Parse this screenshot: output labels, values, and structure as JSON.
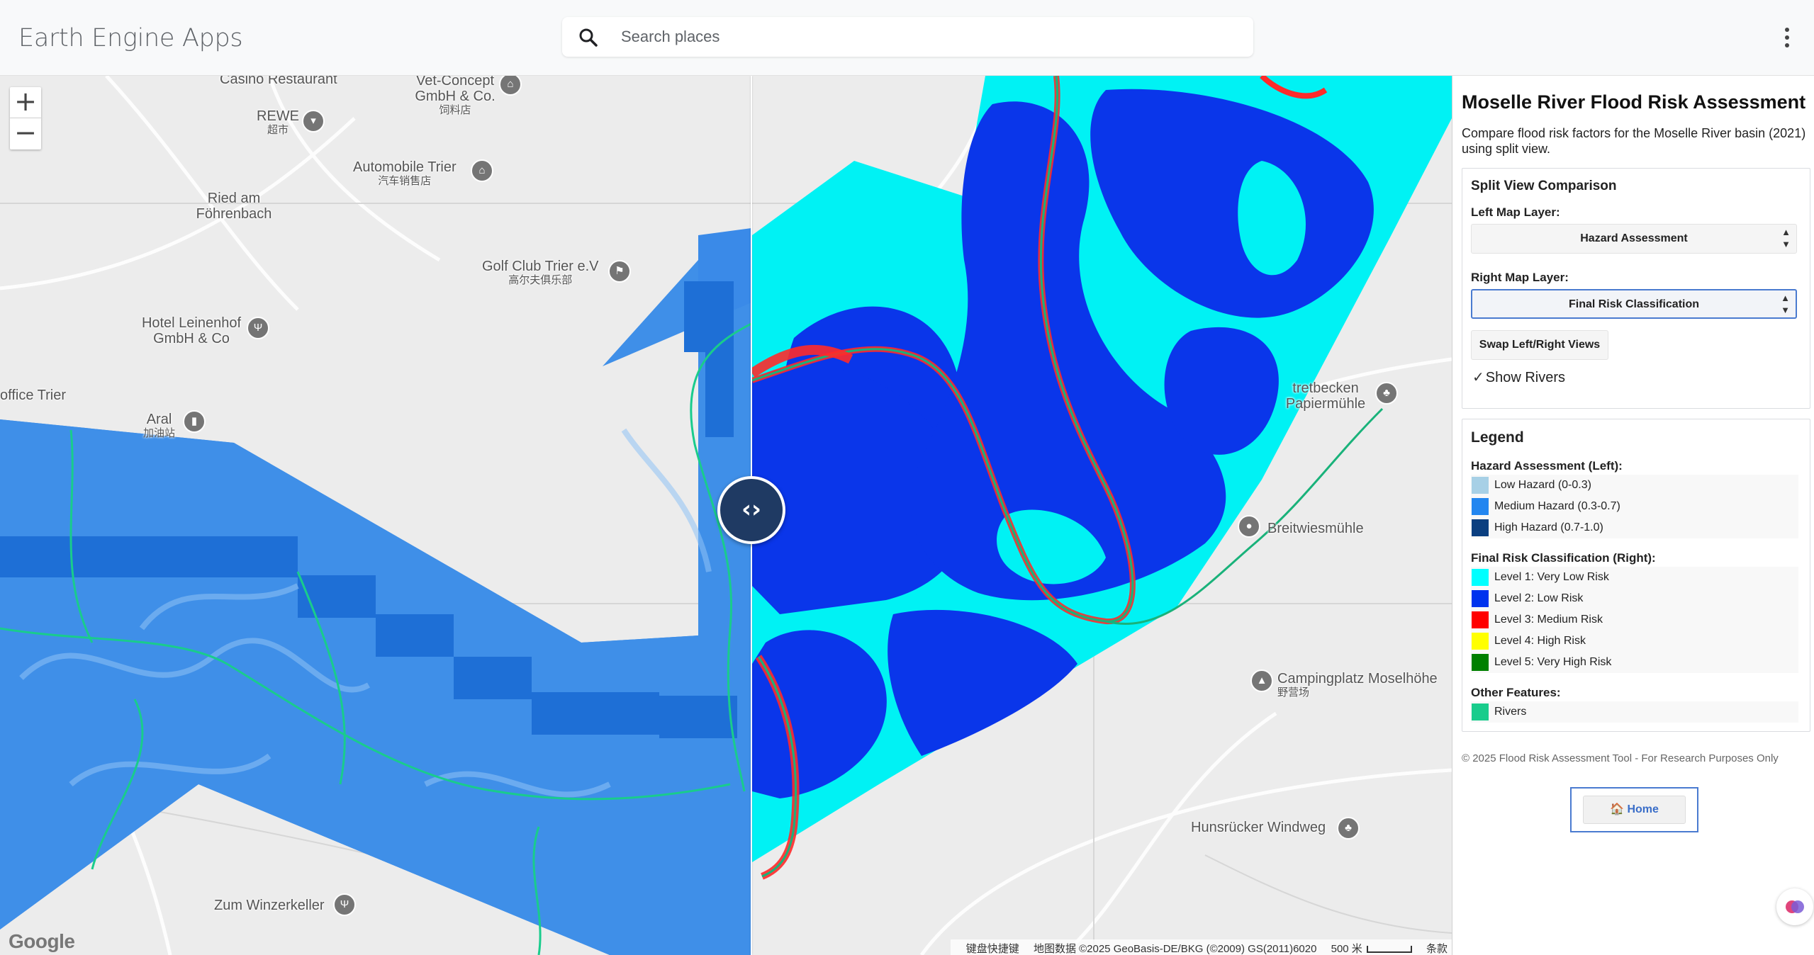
{
  "app": {
    "title": "Earth Engine Apps"
  },
  "search": {
    "placeholder": "Search places",
    "value": ""
  },
  "map": {
    "zoom_in_label": "+",
    "zoom_out_label": "−",
    "split_handle_label": "‹›",
    "places": [
      {
        "name": "Casino Restaurant",
        "sub": ""
      },
      {
        "name": "Vet-Concept GmbH & Co.",
        "sub": "饲料店"
      },
      {
        "name": "REWE",
        "sub": "超市"
      },
      {
        "name": "Automobile Trier",
        "sub": "汽车销售店"
      },
      {
        "name": "Ried am Föhrenbach",
        "sub": ""
      },
      {
        "name": "Golf Club Trier e.V",
        "sub": "高尔夫俱乐部"
      },
      {
        "name": "Hotel Leinenhof GmbH & Co",
        "sub": ""
      },
      {
        "name": "office Trier",
        "sub": ""
      },
      {
        "name": "Aral",
        "sub": "加油站"
      },
      {
        "name": "tretbecken Papiermühle",
        "sub": ""
      },
      {
        "name": "Breitwiesmühle",
        "sub": ""
      },
      {
        "name": "Campingplatz Moselhöhe",
        "sub": "野营场"
      },
      {
        "name": "Hunsrücker Windweg",
        "sub": ""
      },
      {
        "name": "Zum Winzerkeller",
        "sub": ""
      }
    ],
    "google_logo": "Google",
    "attribution": {
      "shortcuts": "键盘快捷键",
      "data": "地图数据 ©2025 GeoBasis-DE/BKG (©2009) GS(2011)6020",
      "scale": "500 米",
      "terms": "条款"
    }
  },
  "panel": {
    "title": "Moselle River Flood Risk Assessment",
    "description": "Compare flood risk factors for the Moselle River basin (2021) using split view.",
    "split_view": {
      "title": "Split View Comparison",
      "left_label": "Left Map Layer:",
      "left_value": "Hazard Assessment",
      "right_label": "Right Map Layer:",
      "right_value": "Final Risk Classification",
      "swap_label": "Swap Left/Right Views",
      "show_rivers_label": "Show Rivers",
      "show_rivers_checked": true
    },
    "legend": {
      "title": "Legend",
      "hazard_head": "Hazard Assessment (Left):",
      "hazard_items": [
        {
          "label": "Low Hazard (0-0.3)",
          "color": "#a7d0e6"
        },
        {
          "label": "Medium Hazard (0.3-0.7)",
          "color": "#2286f0"
        },
        {
          "label": "High Hazard (0.7-1.0)",
          "color": "#0b3f80"
        }
      ],
      "risk_head": "Final Risk Classification (Right):",
      "risk_items": [
        {
          "label": "Level 1: Very Low Risk",
          "color": "#00ffff"
        },
        {
          "label": "Level 2: Low Risk",
          "color": "#0033ee"
        },
        {
          "label": "Level 3: Medium Risk",
          "color": "#ff0000"
        },
        {
          "label": "Level 4: High Risk",
          "color": "#ffff00"
        },
        {
          "label": "Level 5: Very High Risk",
          "color": "#008000"
        }
      ],
      "other_head": "Other Features:",
      "other_items": [
        {
          "label": "Rivers",
          "color": "#19cc8c"
        }
      ]
    },
    "footer": "© 2025 Flood Risk Assessment Tool - For Research Purposes Only",
    "home_label": "🏠 Home"
  }
}
